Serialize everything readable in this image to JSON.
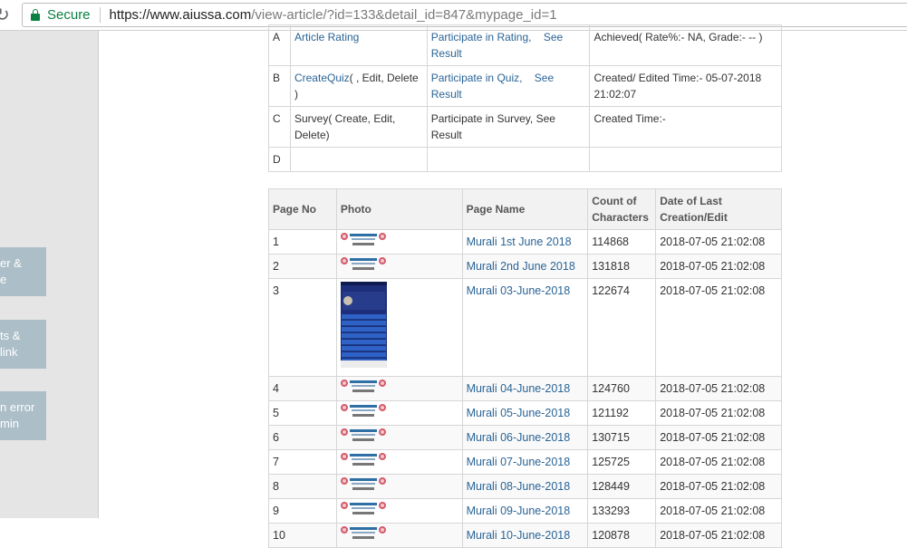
{
  "browser": {
    "secure_label": "Secure",
    "url_host": "https://www.aiussa.com",
    "url_path": "/view-article/?id=133&detail_id=847&mypage_id=1"
  },
  "sidebar": {
    "buttons": [
      {
        "line1": "er &",
        "line2": "e"
      },
      {
        "line1": "ts &",
        "line2": "link"
      },
      {
        "line1": "n error",
        "line2": "min"
      }
    ]
  },
  "activities": {
    "rows": [
      {
        "id": "A",
        "col1": "Article Rating",
        "col1_link": true,
        "col2a": "Participate in Rating,",
        "col2b": "See Result",
        "col2_link": true,
        "col3": "Achieved( Rate%:- NA, Grade:- -- )"
      },
      {
        "id": "B",
        "col1a": "CreateQuiz",
        "col1b": "( , Edit, Delete )",
        "col2a": "Participate in Quiz,",
        "col2b": "See Result",
        "col2_link": true,
        "col3": "Created/ Edited Time:- 05-07-2018 21:02:07"
      },
      {
        "id": "C",
        "col1": "Survey( Create, Edit, Delete)",
        "col2": "Participate in Survey, See Result",
        "col3": "Created Time:-"
      },
      {
        "id": "D",
        "col1": "",
        "col2": "",
        "col3": ""
      }
    ]
  },
  "pages_table": {
    "headers": [
      "Page No",
      "Photo",
      "Page Name",
      "Count of Characters",
      "Date of Last Creation/Edit"
    ],
    "rows": [
      {
        "no": "1",
        "name": "Murali 1st June 2018",
        "count": "114868",
        "date": "2018-07-05 21:02:08",
        "photo": "newspaper"
      },
      {
        "no": "2",
        "name": "Murali 2nd June 2018",
        "count": "131818",
        "date": "2018-07-05 21:02:08",
        "photo": "newspaper"
      },
      {
        "no": "3",
        "name": "Murali 03-June-2018",
        "count": "122674",
        "date": "2018-07-05 21:02:08",
        "photo": "phone-screenshot"
      },
      {
        "no": "4",
        "name": "Murali 04-June-2018",
        "count": "124760",
        "date": "2018-07-05 21:02:08",
        "photo": "newspaper"
      },
      {
        "no": "5",
        "name": "Murali 05-June-2018",
        "count": "121192",
        "date": "2018-07-05 21:02:08",
        "photo": "newspaper"
      },
      {
        "no": "6",
        "name": "Murali 06-June-2018",
        "count": "130715",
        "date": "2018-07-05 21:02:08",
        "photo": "newspaper"
      },
      {
        "no": "7",
        "name": "Murali 07-June-2018",
        "count": "125725",
        "date": "2018-07-05 21:02:08",
        "photo": "newspaper"
      },
      {
        "no": "8",
        "name": "Murali 08-June-2018",
        "count": "128449",
        "date": "2018-07-05 21:02:08",
        "photo": "newspaper"
      },
      {
        "no": "9",
        "name": "Murali 09-June-2018",
        "count": "133293",
        "date": "2018-07-05 21:02:08",
        "photo": "newspaper"
      },
      {
        "no": "10",
        "name": "Murali 10-June-2018",
        "count": "120878",
        "date": "2018-07-05 21:02:08",
        "photo": "newspaper"
      }
    ]
  }
}
